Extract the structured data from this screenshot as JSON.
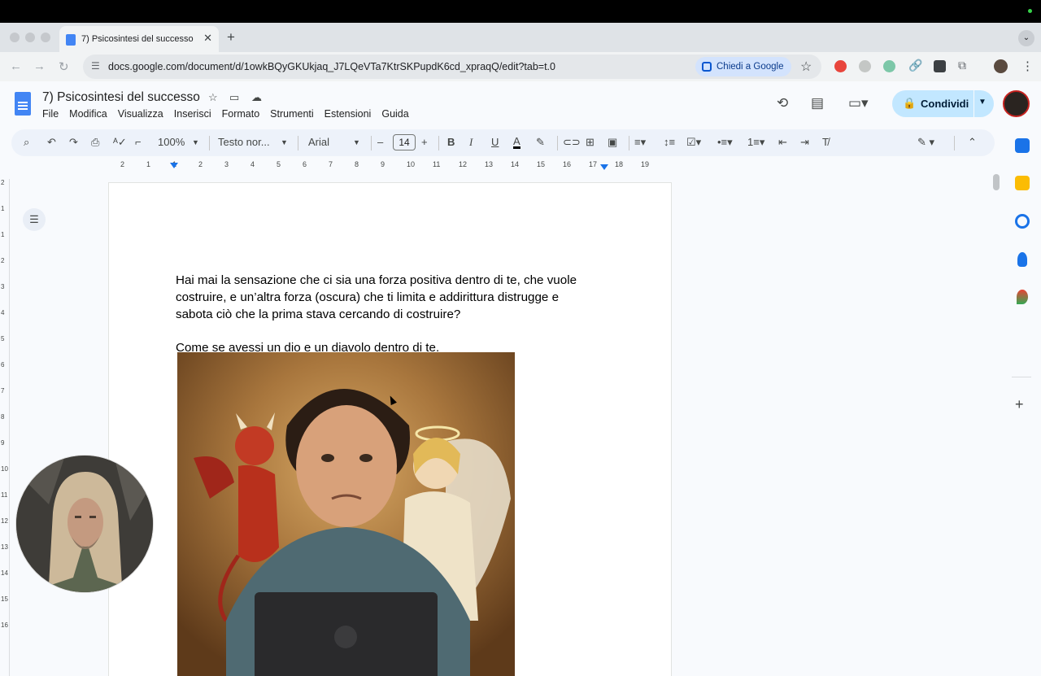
{
  "browser": {
    "tab_title": "7) Psicosintesi del successo",
    "tab_close": "✕",
    "new_tab": "+",
    "url": "docs.google.com/document/d/1owkBQyGKUkjaq_J7LQeVTa7KtrSKPupdK6cd_xpraqQ/edit?tab=t.0",
    "ask_google": "Chiedi a Google"
  },
  "doc": {
    "title": "7) Psicosintesi del successo",
    "menu": [
      "File",
      "Modifica",
      "Visualizza",
      "Inserisci",
      "Formato",
      "Strumenti",
      "Estensioni",
      "Guida"
    ],
    "share_label": "Condividi"
  },
  "toolbar": {
    "zoom": "100%",
    "style": "Testo nor...",
    "font": "Arial",
    "font_size": "14",
    "minus": "–",
    "plus": "+",
    "bold": "B",
    "italic": "I",
    "underline": "U",
    "text_color": "A"
  },
  "ruler": {
    "ticks": [
      "2",
      "1",
      "1",
      "2",
      "3",
      "4",
      "5",
      "6",
      "7",
      "8",
      "9",
      "10",
      "11",
      "12",
      "13",
      "14",
      "15",
      "16",
      "17",
      "18",
      "19"
    ]
  },
  "vruler": {
    "ticks": [
      "2",
      "1",
      "1",
      "2",
      "3",
      "4",
      "5",
      "6",
      "7",
      "8",
      "9",
      "10",
      "11",
      "12",
      "13",
      "14",
      "15",
      "16"
    ]
  },
  "content": {
    "paragraph1": "Hai mai la sensazione che ci sia una forza positiva dentro di te, che vuole costruire, e un’altra forza (oscura) che ti limita e addirittura distrugge e sabota ciò che la prima stava cercando di costruire?",
    "paragraph2": "Come se avessi un dio e un diavolo dentro di te."
  },
  "colors": {
    "accent": "#1a73e8",
    "share_bg": "#c2e7ff",
    "docs_blue": "#4285f4"
  }
}
